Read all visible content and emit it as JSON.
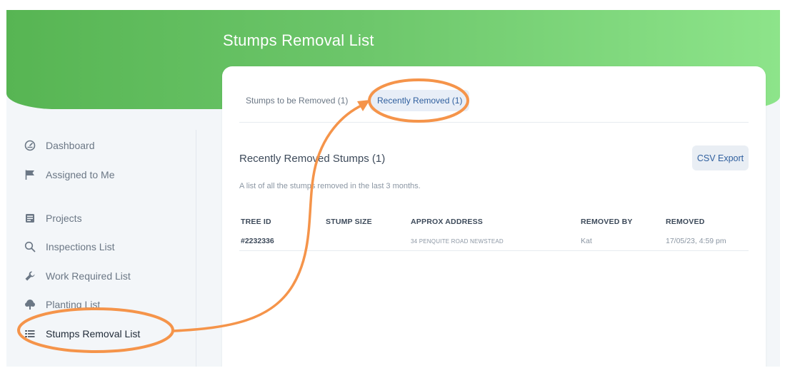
{
  "page": {
    "title": "Stumps Removal List"
  },
  "sidebar": {
    "items": [
      {
        "label": "Dashboard",
        "icon": "gauge-icon"
      },
      {
        "label": "Assigned to Me",
        "icon": "flag-icon"
      },
      {
        "label": "Projects",
        "icon": "projects-icon"
      },
      {
        "label": "Inspections List",
        "icon": "search-icon"
      },
      {
        "label": "Work Required List",
        "icon": "wrench-icon"
      },
      {
        "label": "Planting List",
        "icon": "tree-icon"
      },
      {
        "label": "Stumps Removal List",
        "icon": "list-icon",
        "active": true
      }
    ]
  },
  "tabs": [
    {
      "label": "Stumps to be Removed (1)",
      "active": false
    },
    {
      "label": "Recently Removed (1)",
      "active": true
    }
  ],
  "section": {
    "title": "Recently Removed Stumps (1)",
    "description": "A list of all the stumps removed in the last 3 months.",
    "export_label": "CSV Export"
  },
  "table": {
    "columns": [
      "TREE ID",
      "STUMP SIZE",
      "APPROX ADDRESS",
      "REMOVED BY",
      "REMOVED"
    ],
    "rows": [
      {
        "tree_id": "#2232336",
        "stump_size": "",
        "address": "34 PENQUITE ROAD NEWSTEAD",
        "removed_by": "Kat",
        "removed": "17/05/23, 4:59 pm"
      }
    ]
  },
  "colors": {
    "brand_green": "#5cb85c",
    "accent_blue": "#2f5f9e",
    "annotation_orange": "#f5944a"
  }
}
